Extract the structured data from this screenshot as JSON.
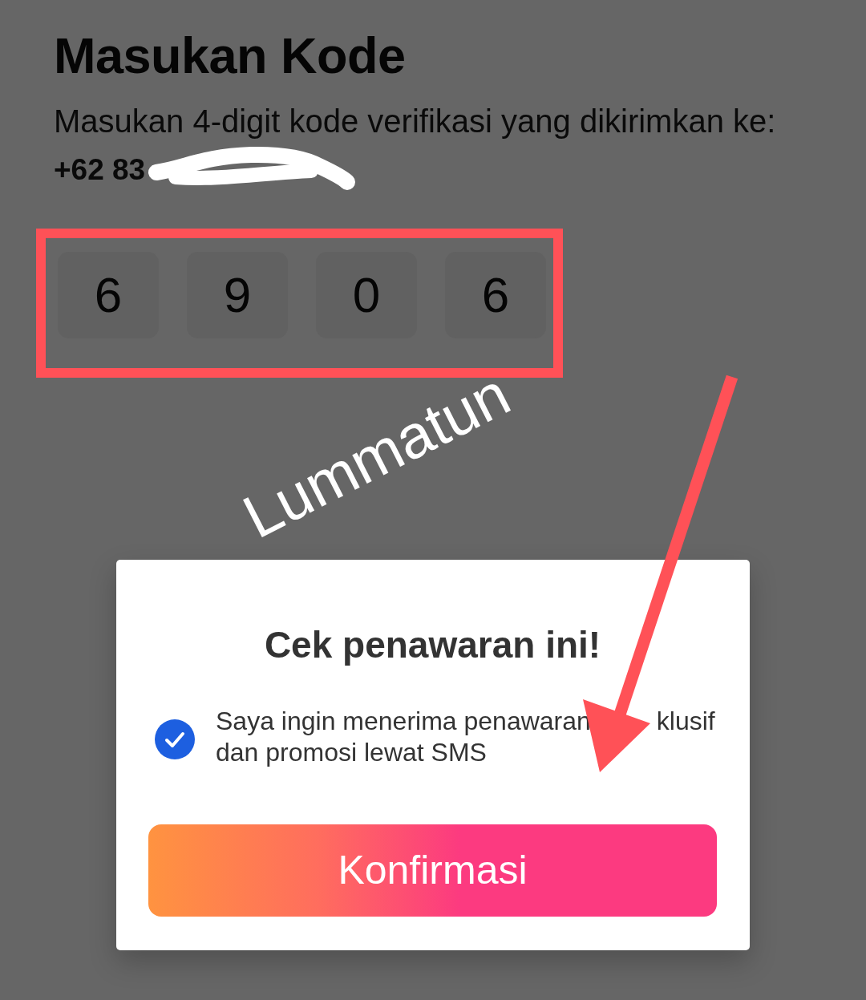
{
  "header": {
    "title": "Masukan Kode",
    "instruction": "Masukan 4-digit kode verifikasi yang dikirimkan ke:",
    "phone_number": "+62 83"
  },
  "code_inputs": [
    {
      "value": "6"
    },
    {
      "value": "9"
    },
    {
      "value": "0"
    },
    {
      "value": "6"
    }
  ],
  "dialog": {
    "title": "Cek penawaran ini!",
    "consent": {
      "checked": true,
      "label_lines": [
        [
          "Saya ingin menerima penawaran",
          "klusif"
        ],
        [
          "dan promosi lewat SMS"
        ]
      ]
    },
    "confirm_button": "Konfirmasi"
  },
  "annotations": [
    {
      "kind": "redaction"
    },
    {
      "kind": "highlight_frame"
    },
    {
      "kind": "text",
      "text": "Lummatun"
    },
    {
      "kind": "arrow"
    }
  ]
}
